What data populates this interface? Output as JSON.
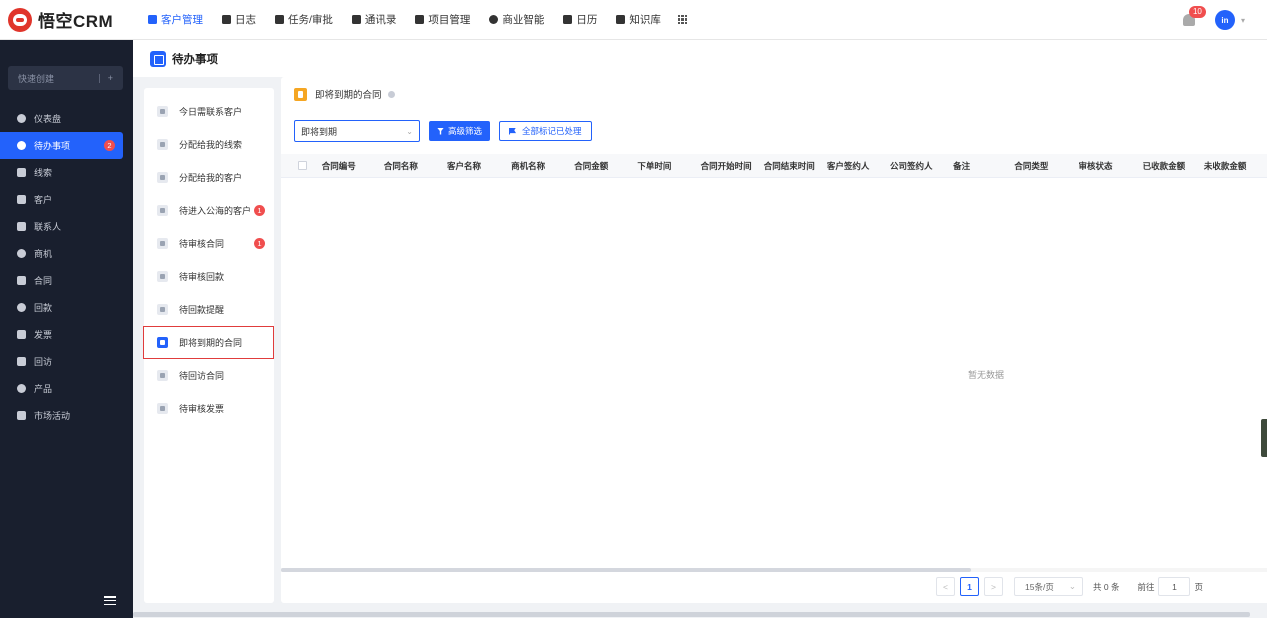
{
  "app": {
    "logo_text": "悟空CRM"
  },
  "topnav": [
    {
      "label": "客户管理",
      "active": true,
      "icon": "customer-icon"
    },
    {
      "label": "日志",
      "icon": "log-icon"
    },
    {
      "label": "任务/审批",
      "icon": "task-icon"
    },
    {
      "label": "通讯录",
      "icon": "contacts-icon"
    },
    {
      "label": "项目管理",
      "icon": "project-icon"
    },
    {
      "label": "商业智能",
      "icon": "bi-icon"
    },
    {
      "label": "日历",
      "icon": "calendar-icon"
    },
    {
      "label": "知识库",
      "icon": "knowledge-icon"
    }
  ],
  "header_right": {
    "notification_count": "10",
    "avatar_text": "in"
  },
  "sidebar": {
    "quick_create": "快速创建",
    "quick_plus": "+",
    "items": [
      {
        "label": "仪表盘",
        "icon": "dashboard-icon"
      },
      {
        "label": "待办事项",
        "icon": "todo-icon",
        "active": true,
        "badge": "2"
      },
      {
        "label": "线索",
        "icon": "leads-icon"
      },
      {
        "label": "客户",
        "icon": "customer-icon"
      },
      {
        "label": "联系人",
        "icon": "contact-icon"
      },
      {
        "label": "商机",
        "icon": "opportunity-icon"
      },
      {
        "label": "合同",
        "icon": "contract-icon"
      },
      {
        "label": "回款",
        "icon": "payment-icon"
      },
      {
        "label": "发票",
        "icon": "invoice-icon"
      },
      {
        "label": "回访",
        "icon": "visit-icon"
      },
      {
        "label": "产品",
        "icon": "product-icon"
      },
      {
        "label": "市场活动",
        "icon": "campaign-icon"
      }
    ]
  },
  "page": {
    "title": "待办事项"
  },
  "todo_list": [
    {
      "label": "今日需联系客户"
    },
    {
      "label": "分配给我的线索"
    },
    {
      "label": "分配给我的客户"
    },
    {
      "label": "待进入公海的客户",
      "badge": "1"
    },
    {
      "label": "待审核合同",
      "badge": "1"
    },
    {
      "label": "待审核回款"
    },
    {
      "label": "待回款提醒"
    },
    {
      "label": "即将到期的合同",
      "active": true
    },
    {
      "label": "待回访合同"
    },
    {
      "label": "待审核发票"
    }
  ],
  "main": {
    "title": "即将到期的合同",
    "filter_value": "即将到期",
    "advanced_filter": "高级筛选",
    "mark_all": "全部标记已处理",
    "columns": [
      "合同编号",
      "合同名称",
      "客户名称",
      "商机名称",
      "合同金额",
      "下单时间",
      "合同开始时间",
      "合同结束时间",
      "客户签约人",
      "公司签约人",
      "备注",
      "合同类型",
      "审核状态",
      "已收款金额",
      "未收款金额"
    ],
    "empty_text": "暂无数据"
  },
  "pagination": {
    "prev": "<",
    "next": ">",
    "current": "1",
    "page_size": "15条/页",
    "total": "共 0 条",
    "goto_label": "前往",
    "goto_value": "1",
    "goto_suffix": "页"
  }
}
